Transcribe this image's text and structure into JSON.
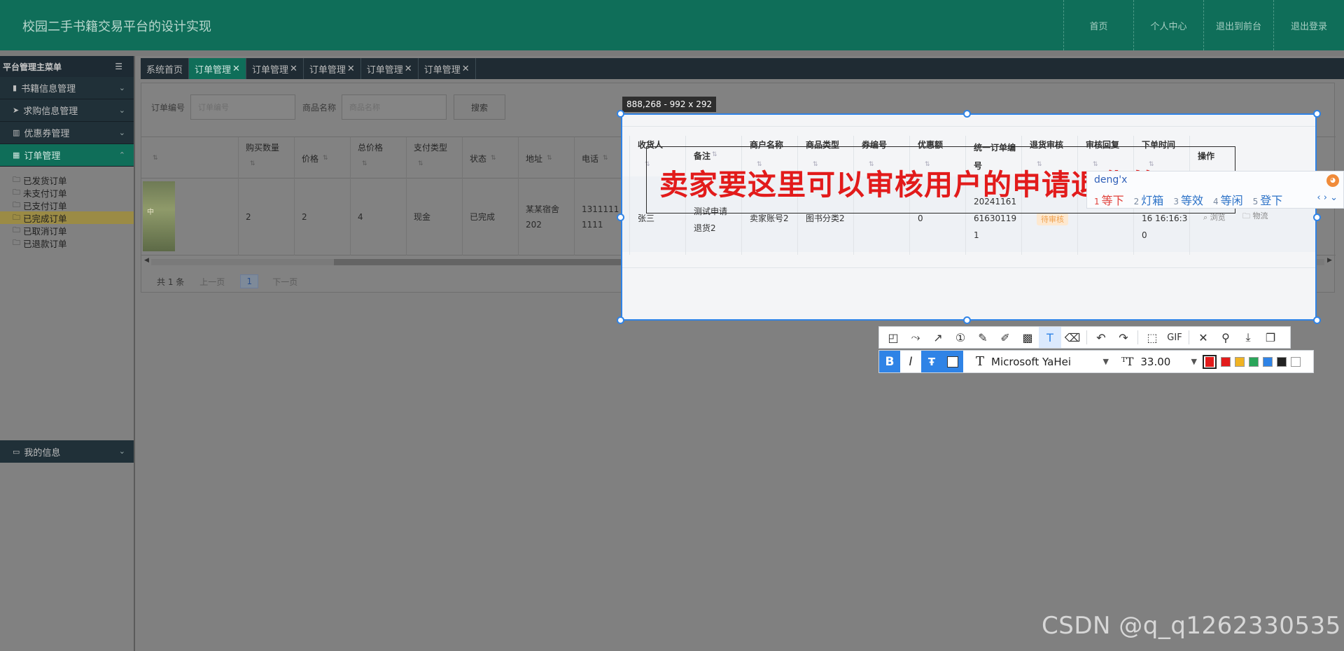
{
  "header": {
    "title": "校园二手书籍交易平台的设计实现",
    "nav": [
      "首页",
      "个人中心",
      "退出到前台",
      "退出登录"
    ]
  },
  "sidebar": {
    "head": "平台管理主菜单",
    "menus": [
      {
        "label": "书籍信息管理",
        "icon": "book-icon"
      },
      {
        "label": "求购信息管理",
        "icon": "send-icon"
      },
      {
        "label": "优惠券管理",
        "icon": "bar-chart-icon"
      },
      {
        "label": "订单管理",
        "icon": "grid-icon"
      }
    ],
    "sub_items": [
      "已发货订单",
      "未支付订单",
      "已支付订单",
      "已完成订单",
      "已取消订单",
      "已退款订单"
    ],
    "selected_sub": "已完成订单",
    "bottom_menu": "我的信息"
  },
  "tabs": [
    "系统首页",
    "订单管理",
    "订单管理",
    "订单管理",
    "订单管理",
    "订单管理"
  ],
  "search": {
    "order_label": "订单编号",
    "order_placeholder": "订单编号",
    "goods_label": "商品名称",
    "goods_placeholder": "商品名称",
    "button": "搜索"
  },
  "table": {
    "headers": [
      "购买数量",
      "价格",
      "总价格",
      "支付类型",
      "状态",
      "地址",
      "电话"
    ],
    "row": {
      "image_text": "中",
      "quantity": "2",
      "price": "2",
      "total": "4",
      "pay_type": "现金",
      "status": "已完成",
      "address": "某某宿舍202",
      "phone": "13111111111"
    }
  },
  "pager": {
    "total": "共 1 条",
    "prev": "上一页",
    "page": "1",
    "next": "下一页"
  },
  "capture": {
    "info": "888,268 - 992 x 292",
    "headers": [
      "收货人",
      "备注",
      "商户名称",
      "商品类型",
      "券编号",
      "优惠额",
      "统一订单编号",
      "退货审核",
      "审核回复",
      "下单时间",
      "操作"
    ],
    "row": {
      "receiver": "张三",
      "remark_1": "测试申请",
      "remark_2": "退货2",
      "merchant": "卖家账号2",
      "category": "图书分类2",
      "discount": "0",
      "order_no_1": "20241161",
      "order_no_2": "61630119",
      "order_no_3": "1",
      "audit": "待审核",
      "time_1": "16 16:16:3",
      "time_2": "0",
      "op_view": "浏览",
      "op_logistics": "物流"
    },
    "annotation_text": "卖家要这里可以审核用户的申请退货的"
  },
  "ime": {
    "composition": "deng'x",
    "candidates": [
      {
        "n": "1",
        "t": "等下"
      },
      {
        "n": "2",
        "t": "灯箱"
      },
      {
        "n": "3",
        "t": "等效"
      },
      {
        "n": "4",
        "t": "等闲"
      },
      {
        "n": "5",
        "t": "登下"
      }
    ]
  },
  "toolbar": {
    "gif_label": "GIF",
    "font_name": "Microsoft YaHei",
    "font_size": "33.00",
    "colors": [
      "#e21b1b",
      "#e21b1b",
      "#f0b323",
      "#2aa55a",
      "#2f83e6",
      "#222222",
      "#ffffff"
    ]
  },
  "watermark": "CSDN @q_q1262330535"
}
